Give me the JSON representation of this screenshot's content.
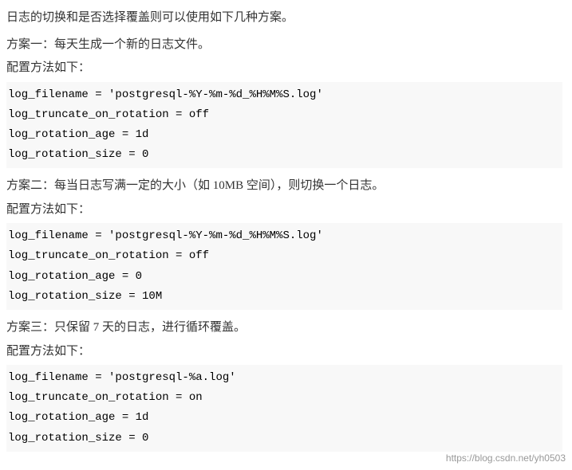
{
  "intro": {
    "text": "日志的切换和是否选择覆盖则可以使用如下几种方案。"
  },
  "sections": [
    {
      "id": "section1",
      "heading": "方案一：每天生成一个新的日志文件。",
      "config_label": "配置方法如下：",
      "code_lines": [
        "log_filename = 'postgresql-%Y-%m-%d_%H%M%S.log'",
        "log_truncate_on_rotation = off",
        "log_rotation_age = 1d",
        "log_rotation_size = 0"
      ]
    },
    {
      "id": "section2",
      "heading": "方案二：每当日志写满一定的大小（如 10MB 空间），则切换一个日志。",
      "config_label": "配置方法如下：",
      "code_lines": [
        "log_filename = 'postgresql-%Y-%m-%d_%H%M%S.log'",
        "log_truncate_on_rotation = off",
        "log_rotation_age = 0",
        "log_rotation_size = 10M"
      ]
    },
    {
      "id": "section3",
      "heading": "方案三：只保留 7 天的日志，进行循环覆盖。",
      "config_label": "配置方法如下：",
      "code_lines": [
        "log_filename = 'postgresql-%a.log'",
        "log_truncate_on_rotation = on",
        "log_rotation_age = 1d",
        "log_rotation_size = 0"
      ]
    }
  ],
  "watermark": {
    "text": "https://blog.csdn.net/yh0503"
  }
}
